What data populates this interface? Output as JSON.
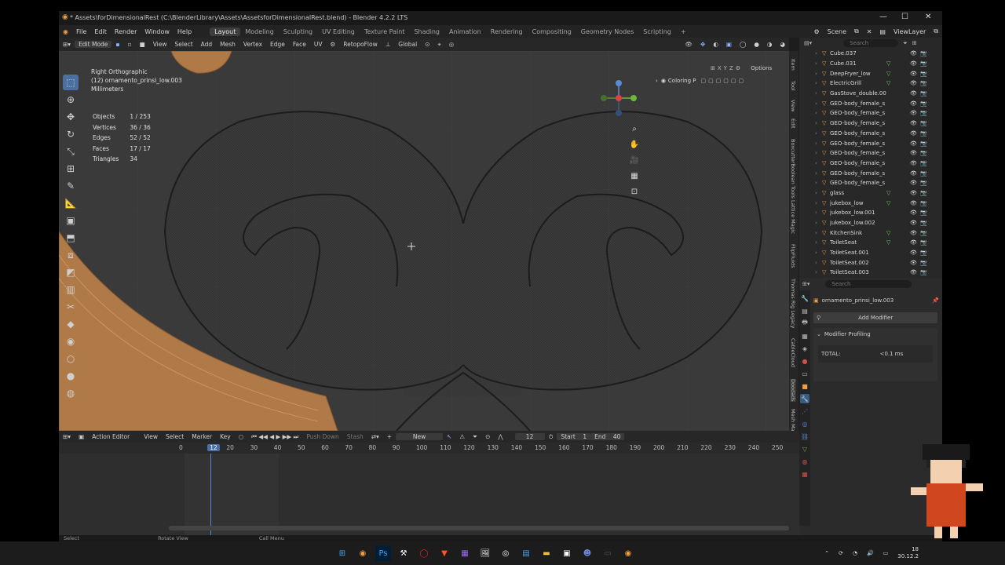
{
  "window": {
    "title": "* Assets\\forDimensionalRest (C:\\BlenderLibrary\\Assets\\AssetsforDimensionalRest.blend) - Blender 4.2.2 LTS",
    "controls": [
      "—",
      "☐",
      "✕"
    ]
  },
  "menus": [
    "File",
    "Edit",
    "Render",
    "Window",
    "Help"
  ],
  "workspaces": [
    "Layout",
    "Modeling",
    "Sculpting",
    "UV Editing",
    "Texture Paint",
    "Shading",
    "Animation",
    "Rendering",
    "Compositing",
    "Geometry Nodes",
    "Scripting"
  ],
  "active_workspace": "Layout",
  "scene": {
    "label": "Scene",
    "view_layer": "ViewLayer"
  },
  "viewport_header": {
    "mode": "Edit Mode",
    "items": [
      "View",
      "Select",
      "Add",
      "Mesh",
      "Vertex",
      "Edge",
      "Face",
      "UV"
    ],
    "addon": "RetopoFlow",
    "transform": "Global",
    "options": "Options"
  },
  "overlay": {
    "view": "Right Orthographic",
    "object": "(12) ornamento_prinsi_low.003",
    "units": "Millimeters"
  },
  "stats": [
    {
      "label": "Objects",
      "value": "1 / 253"
    },
    {
      "label": "Vertices",
      "value": "36 / 36"
    },
    {
      "label": "Edges",
      "value": "52 / 52"
    },
    {
      "label": "Faces",
      "value": "17 / 17"
    },
    {
      "label": "Triangles",
      "value": "34"
    }
  ],
  "coloring_label": "Coloring P",
  "sidebar_tabs": [
    "Item",
    "Tool",
    "View",
    "Edit",
    "BoxcutterBoolean Tools",
    "Lattice Magic",
    "FlipFluids",
    "Thomas Rig Legacy",
    "CableCloud",
    "Doodads",
    "Mesh Ma"
  ],
  "outliner": {
    "search_placeholder": "Search",
    "items": [
      {
        "name": "Cube.037",
        "ext": ""
      },
      {
        "name": "Cube.031",
        "ext": "▽"
      },
      {
        "name": "DeepFryer_low",
        "ext": "▽"
      },
      {
        "name": "ElectricGrill",
        "ext": "▽"
      },
      {
        "name": "GasStove_double.00",
        "ext": ""
      },
      {
        "name": "GEO-body_female_s",
        "ext": ""
      },
      {
        "name": "GEO-body_female_s",
        "ext": ""
      },
      {
        "name": "GEO-body_female_s",
        "ext": ""
      },
      {
        "name": "GEO-body_female_s",
        "ext": ""
      },
      {
        "name": "GEO-body_female_s",
        "ext": ""
      },
      {
        "name": "GEO-body_female_s",
        "ext": ""
      },
      {
        "name": "GEO-body_female_s",
        "ext": ""
      },
      {
        "name": "GEO-body_female_s",
        "ext": ""
      },
      {
        "name": "GEO-body_female_s",
        "ext": ""
      },
      {
        "name": "glass",
        "ext": "▽"
      },
      {
        "name": "jukebox_low",
        "ext": "▽"
      },
      {
        "name": "jukebox_low.001",
        "ext": ""
      },
      {
        "name": "jukebox_low.002",
        "ext": ""
      },
      {
        "name": "KitchenSink",
        "ext": "▽"
      },
      {
        "name": "ToiletSeat",
        "ext": "▽"
      },
      {
        "name": "ToiletSeat.001",
        "ext": ""
      },
      {
        "name": "ToiletSeat.002",
        "ext": ""
      },
      {
        "name": "ToiletSeat.003",
        "ext": ""
      }
    ]
  },
  "properties": {
    "search_placeholder": "Search",
    "object_name": "ornamento_prinsi_low.003",
    "add_modifier": "Add Modifier",
    "panel_title": "Modifier Profiling",
    "total_label": "TOTAL:",
    "total_value": "<0.1 ms"
  },
  "timeline": {
    "editor": "Action Editor",
    "items": [
      "View",
      "Select",
      "Marker",
      "Key"
    ],
    "push_down": "Push Down",
    "stash": "Stash",
    "new": "New",
    "current_frame": "12",
    "start_label": "Start",
    "start_value": "1",
    "end_label": "End",
    "end_value": "40",
    "ruler": [
      "0",
      "12",
      "20",
      "30",
      "40",
      "50",
      "60",
      "70",
      "80",
      "90",
      "100",
      "110",
      "120",
      "130",
      "140",
      "150",
      "160",
      "170",
      "180",
      "190",
      "200",
      "210",
      "220",
      "230",
      "240",
      "250"
    ]
  },
  "status_bar": [
    "Select",
    "Rotate View",
    "Call Menu"
  ],
  "taskbar": {
    "clock_time": "18",
    "clock_date": "30.12.2"
  },
  "colors": {
    "accent": "#4a6fa0",
    "object_orange": "#f0a040",
    "mesh_wire": "#1c1c1c",
    "wood_mesh": "#c08a55"
  }
}
